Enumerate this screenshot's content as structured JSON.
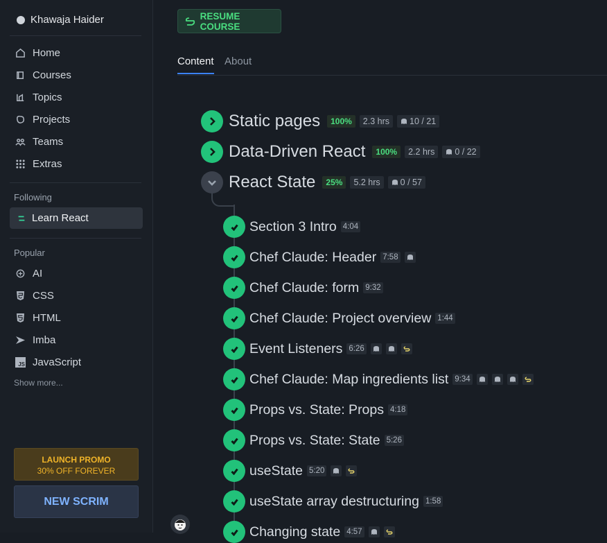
{
  "sidebar": {
    "user_name": "Khawaja Haider",
    "nav": [
      {
        "label": "Home",
        "icon": "home-icon"
      },
      {
        "label": "Courses",
        "icon": "courses-icon"
      },
      {
        "label": "Topics",
        "icon": "topics-icon"
      },
      {
        "label": "Projects",
        "icon": "projects-icon"
      },
      {
        "label": "Teams",
        "icon": "teams-icon"
      },
      {
        "label": "Extras",
        "icon": "grid-icon"
      }
    ],
    "following_label": "Following",
    "following_item": "Learn React",
    "popular_label": "Popular",
    "popular": [
      {
        "label": "AI",
        "icon": "ai-icon"
      },
      {
        "label": "CSS",
        "icon": "css-icon"
      },
      {
        "label": "HTML",
        "icon": "html-icon"
      },
      {
        "label": "Imba",
        "icon": "imba-icon"
      },
      {
        "label": "JavaScript",
        "icon": "javascript-icon",
        "icon_text": "JS"
      }
    ],
    "show_more": "Show more...",
    "promo_title": "LAUNCH PROMO",
    "promo_sub": "30% OFF FOREVER",
    "new_scrim": "NEW SCRIM"
  },
  "main": {
    "resume_label": "RESUME COURSE",
    "tabs": [
      "Content",
      "About"
    ],
    "sections": [
      {
        "title": "Static pages",
        "progress": "100%",
        "hours": "2.3 hrs",
        "challenges": "10 / 21",
        "state": "done"
      },
      {
        "title": "Data-Driven React",
        "progress": "100%",
        "hours": "2.2 hrs",
        "challenges": "0 / 22",
        "state": "done"
      },
      {
        "title": "React State",
        "progress": "25%",
        "hours": "5.2 hrs",
        "challenges": "0 / 57",
        "state": "open"
      }
    ],
    "lessons": [
      {
        "title": "Section 3 Intro",
        "duration": "4:04",
        "icons": []
      },
      {
        "title": "Chef Claude: Header",
        "duration": "7:58",
        "icons": [
          "ghost"
        ]
      },
      {
        "title": "Chef Claude: form",
        "duration": "9:32",
        "icons": []
      },
      {
        "title": "Chef Claude: Project overview",
        "duration": "1:44",
        "icons": []
      },
      {
        "title": "Event Listeners",
        "duration": "6:26",
        "icons": [
          "ghost",
          "ghost",
          "scrim"
        ]
      },
      {
        "title": "Chef Claude: Map ingredients list",
        "duration": "9:34",
        "icons": [
          "ghost",
          "ghost",
          "ghost",
          "scrim"
        ]
      },
      {
        "title": "Props vs. State: Props",
        "duration": "4:18",
        "icons": []
      },
      {
        "title": "Props vs. State: State",
        "duration": "5:26",
        "icons": []
      },
      {
        "title": "useState",
        "duration": "5:20",
        "icons": [
          "ghost",
          "scrim"
        ]
      },
      {
        "title": "useState array destructuring",
        "duration": "1:58",
        "icons": []
      },
      {
        "title": "Changing state",
        "duration": "4:57",
        "icons": [
          "ghost",
          "scrim"
        ]
      }
    ]
  },
  "colors": {
    "accent_green": "#22c27a",
    "tab_underline": "#3b82f6",
    "promo": "#f0b429",
    "scrim_blue": "#7fb3ff"
  }
}
